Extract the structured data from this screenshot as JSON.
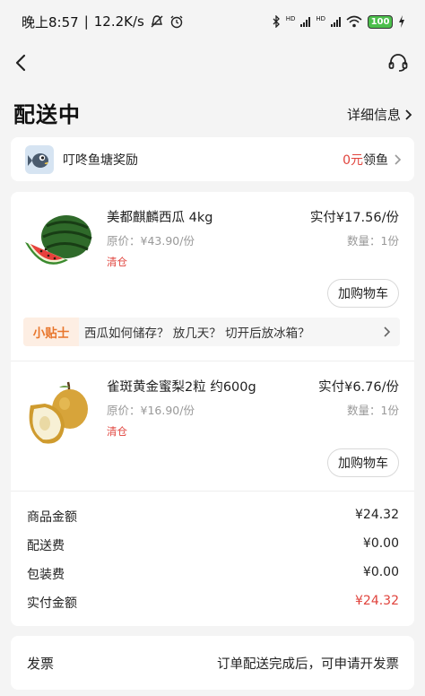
{
  "status_bar": {
    "time": "晚上8:57",
    "speed": "12.2K/s",
    "network_1": "HD",
    "network_2": "HD",
    "battery": "100"
  },
  "nav": {
    "title": "配送中",
    "detail_label": "详细信息"
  },
  "reward": {
    "title": "叮咚鱼塘奖励",
    "amount": "0元",
    "action": "领鱼"
  },
  "products": [
    {
      "name": "美都麒麟西瓜 4kg",
      "paid": "实付¥17.56/份",
      "original": "原价：¥43.90/份",
      "quantity": "数量：1份",
      "tag": "清仓",
      "cart_label": "加购物车",
      "icon": "watermelon-image"
    },
    {
      "name": "雀斑黄金蜜梨2粒 约600g",
      "paid": "实付¥6.76/份",
      "original": "原价：¥16.90/份",
      "quantity": "数量：1份",
      "tag": "清仓",
      "cart_label": "加购物车",
      "icon": "pear-image"
    }
  ],
  "tip": {
    "label": "小贴士",
    "text": "西瓜如何储存？ 放几天？ 切开后放冰箱？"
  },
  "summary": {
    "goods_label": "商品金额",
    "goods_value": "¥24.32",
    "delivery_label": "配送费",
    "delivery_value": "¥0.00",
    "packing_label": "包装费",
    "packing_value": "¥0.00",
    "paid_label": "实付金额",
    "paid_value": "¥24.32"
  },
  "invoice": {
    "label": "发票",
    "note": "订单配送完成后，可申请开发票"
  },
  "colors": {
    "accent_red": "#e0433c",
    "tip_orange": "#e8762c",
    "background": "#f4f4f4"
  }
}
